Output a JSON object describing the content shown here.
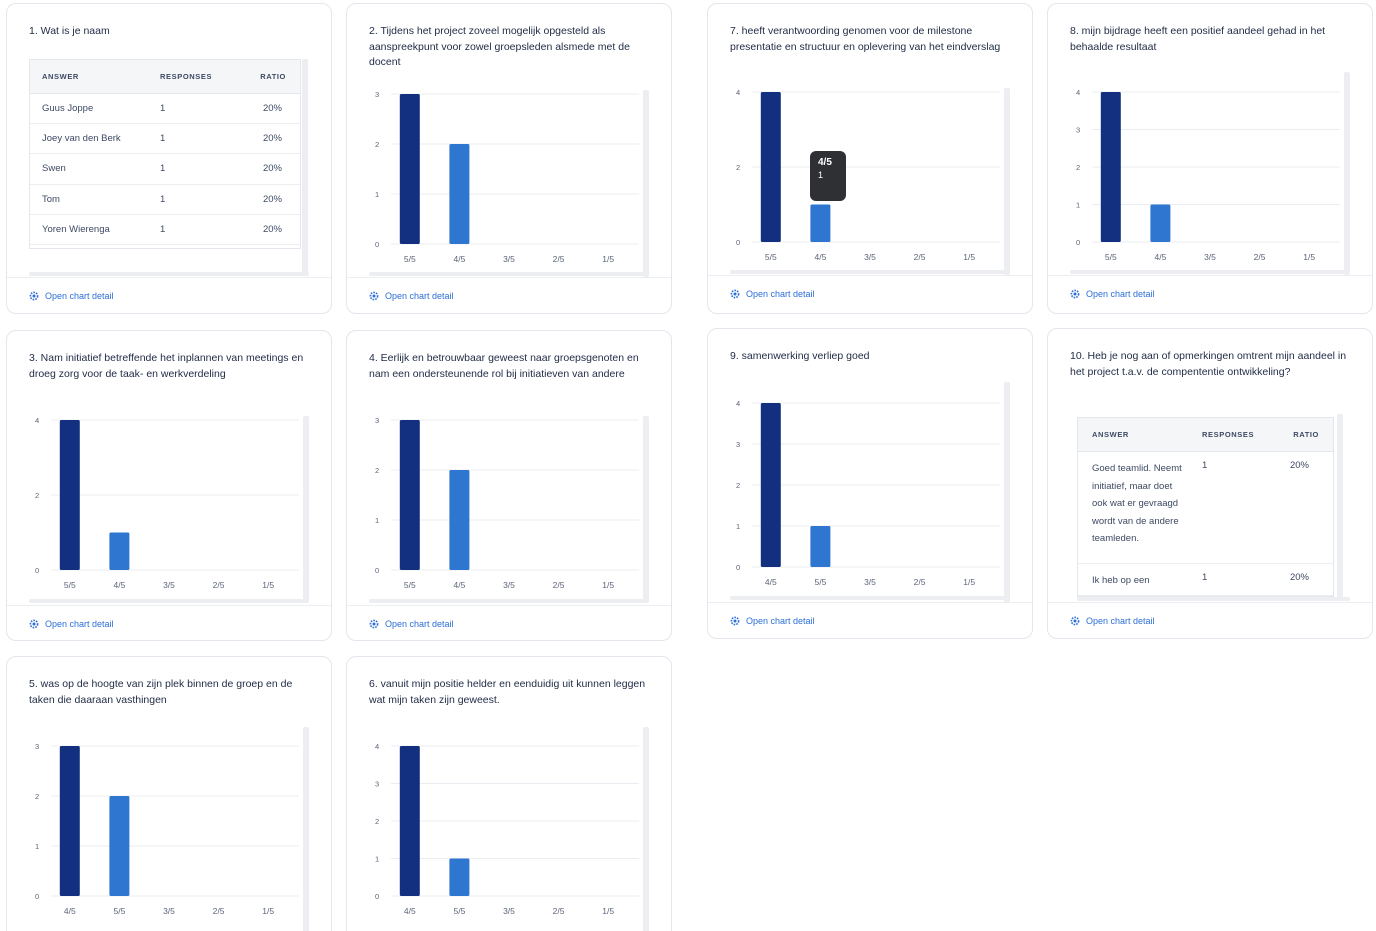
{
  "footer_label": "Open chart detail",
  "colors": {
    "bar_dark": "#12307f",
    "bar_light": "#2e76d0",
    "grid": "#e9ecf1",
    "axis_text": "#5b6478"
  },
  "cards": {
    "q1": {
      "title": "1. Wat is je naam",
      "table": {
        "headers": [
          "ANSWER",
          "RESPONSES",
          "RATIO"
        ],
        "rows": [
          [
            "Guus Joppe",
            "1",
            "20%"
          ],
          [
            "Joey van den Berk",
            "1",
            "20%"
          ],
          [
            "Swen",
            "1",
            "20%"
          ],
          [
            "Tom",
            "1",
            "20%"
          ],
          [
            "Yoren Wierenga",
            "1",
            "20%"
          ]
        ]
      }
    },
    "q2": {
      "title": "2. Tijdens het project zoveel mogelijk opgesteld als aanspreekpunt voor zowel groepsleden alsmede met de docent"
    },
    "q3": {
      "title": "3. Nam initiatief betreffende het inplannen van meetings en droeg zorg voor de taak- en werkverdeling"
    },
    "q4": {
      "title": "4. Eerlijk en betrouwbaar geweest naar groepsgenoten en nam een ondersteunende rol bij initiatieven van andere"
    },
    "q5": {
      "title": "5. was op de hoogte van zijn plek binnen de groep en de taken die daaraan vasthingen"
    },
    "q6": {
      "title": "6. vanuit mijn positie helder en eenduidig uit kunnen leggen wat mijn taken zijn geweest."
    },
    "q7": {
      "title": "7. heeft verantwoording genomen voor de milestone presentatie en structuur en oplevering van het eindverslag",
      "tooltip": {
        "label": "4/5",
        "value": "1"
      }
    },
    "q8": {
      "title": "8. mijn bijdrage heeft een positief aandeel gehad in het behaalde resultaat"
    },
    "q9": {
      "title": "9. samenwerking verliep goed"
    },
    "q10": {
      "title": "10. Heb je nog aan of opmerkingen omtrent mijn aandeel in het project t.a.v. de compententie ontwikkeling?",
      "table": {
        "headers": [
          "ANSWER",
          "RESPONSES",
          "RATIO"
        ],
        "rows": [
          [
            "Goed teamlid. Neemt initiatief, maar doet ook wat er gevraagd wordt van de andere teamleden.",
            "1",
            "20%"
          ],
          [
            "Ik heb op een",
            "1",
            "20%"
          ]
        ]
      }
    }
  },
  "chart_data": [
    {
      "id": "q2",
      "type": "bar",
      "categories": [
        "5/5",
        "4/5",
        "3/5",
        "2/5",
        "1/5"
      ],
      "values": [
        3,
        2,
        0,
        0,
        0
      ],
      "yticks": [
        0,
        1,
        2,
        3
      ],
      "ylim": [
        0,
        3
      ]
    },
    {
      "id": "q3",
      "type": "bar",
      "categories": [
        "5/5",
        "4/5",
        "3/5",
        "2/5",
        "1/5"
      ],
      "values": [
        4,
        1,
        0,
        0,
        0
      ],
      "yticks": [
        0,
        2,
        4
      ],
      "ylim": [
        0,
        4
      ]
    },
    {
      "id": "q4",
      "type": "bar",
      "categories": [
        "5/5",
        "4/5",
        "3/5",
        "2/5",
        "1/5"
      ],
      "values": [
        3,
        2,
        0,
        0,
        0
      ],
      "yticks": [
        0,
        1,
        2,
        3
      ],
      "ylim": [
        0,
        3
      ]
    },
    {
      "id": "q5",
      "type": "bar",
      "categories": [
        "4/5",
        "5/5",
        "3/5",
        "2/5",
        "1/5"
      ],
      "values": [
        3,
        2,
        0,
        0,
        0
      ],
      "yticks": [
        0,
        1,
        2,
        3
      ],
      "ylim": [
        0,
        3
      ]
    },
    {
      "id": "q6",
      "type": "bar",
      "categories": [
        "4/5",
        "5/5",
        "3/5",
        "2/5",
        "1/5"
      ],
      "values": [
        4,
        1,
        0,
        0,
        0
      ],
      "yticks": [
        0,
        1,
        2,
        3,
        4
      ],
      "ylim": [
        0,
        4
      ]
    },
    {
      "id": "q7",
      "type": "bar",
      "categories": [
        "5/5",
        "4/5",
        "3/5",
        "2/5",
        "1/5"
      ],
      "values": [
        4,
        1,
        0,
        0,
        0
      ],
      "yticks": [
        0,
        2,
        4
      ],
      "ylim": [
        0,
        4
      ]
    },
    {
      "id": "q8",
      "type": "bar",
      "categories": [
        "5/5",
        "4/5",
        "3/5",
        "2/5",
        "1/5"
      ],
      "values": [
        4,
        1,
        0,
        0,
        0
      ],
      "yticks": [
        0,
        1,
        2,
        3,
        4
      ],
      "ylim": [
        0,
        4
      ]
    },
    {
      "id": "q9",
      "type": "bar",
      "categories": [
        "4/5",
        "5/5",
        "3/5",
        "2/5",
        "1/5"
      ],
      "values": [
        4,
        1,
        0,
        0,
        0
      ],
      "yticks": [
        0,
        1,
        2,
        3,
        4
      ],
      "ylim": [
        0,
        4
      ]
    }
  ]
}
